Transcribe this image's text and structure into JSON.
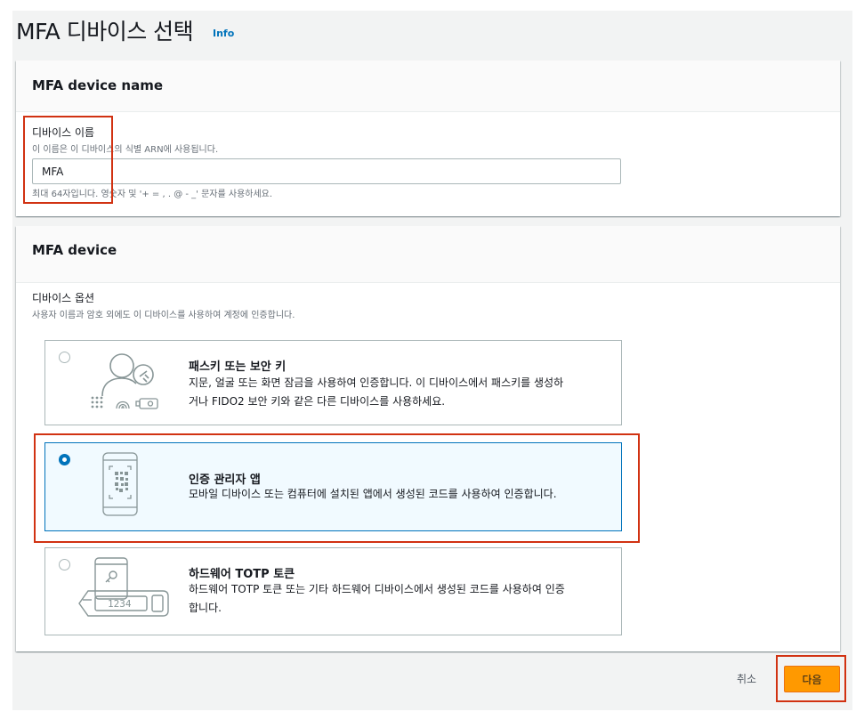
{
  "page": {
    "title": "MFA 디바이스 선택",
    "info_label": "Info"
  },
  "device_name_panel": {
    "header": "MFA device name",
    "field_label": "디바이스 이름",
    "field_description": "이 이름은 이 디바이스의 식별 ARN에 사용됩니다.",
    "input_value": "MFA",
    "constraint": "최대 64자입니다. 영숫자 및 '+ = , . @ - _' 문자를 사용하세요."
  },
  "device_panel": {
    "header": "MFA device",
    "options_label": "디바이스 옵션",
    "options_description": "사용자 이름과 암호 외에도 이 디바이스를 사용하여 계정에 인증합니다.",
    "options": [
      {
        "title": "패스키 또는 보안 키",
        "line1": "지문, 얼굴 또는 화면 잠금을 사용하여 인증합니다. 이 디바이스에서 패스키를 생성하",
        "line2": "거나 FIDO2 보안 키와 같은 다른 디바이스를 사용하세요.",
        "icon": "passkey-icon",
        "selected": false
      },
      {
        "title": "인증 관리자 앱",
        "line1": "모바일 디바이스 또는 컴퓨터에 설치된 앱에서 생성된 코드를 사용하여 인증합니다.",
        "icon": "authenticator-app-icon",
        "selected": true
      },
      {
        "title": "하드웨어 TOTP 토큰",
        "line1": "하드웨어 TOTP 토큰 또는 기타 하드웨어 디바이스에서 생성된 코드를 사용하여 인증",
        "line2": "합니다.",
        "icon": "hardware-token-icon",
        "token_display": "1234",
        "selected": false
      }
    ]
  },
  "footer": {
    "cancel_label": "취소",
    "next_label": "다음"
  },
  "colors": {
    "accent": "#0073bb",
    "primary_button": "#ff9900",
    "highlight": "#d13212"
  }
}
